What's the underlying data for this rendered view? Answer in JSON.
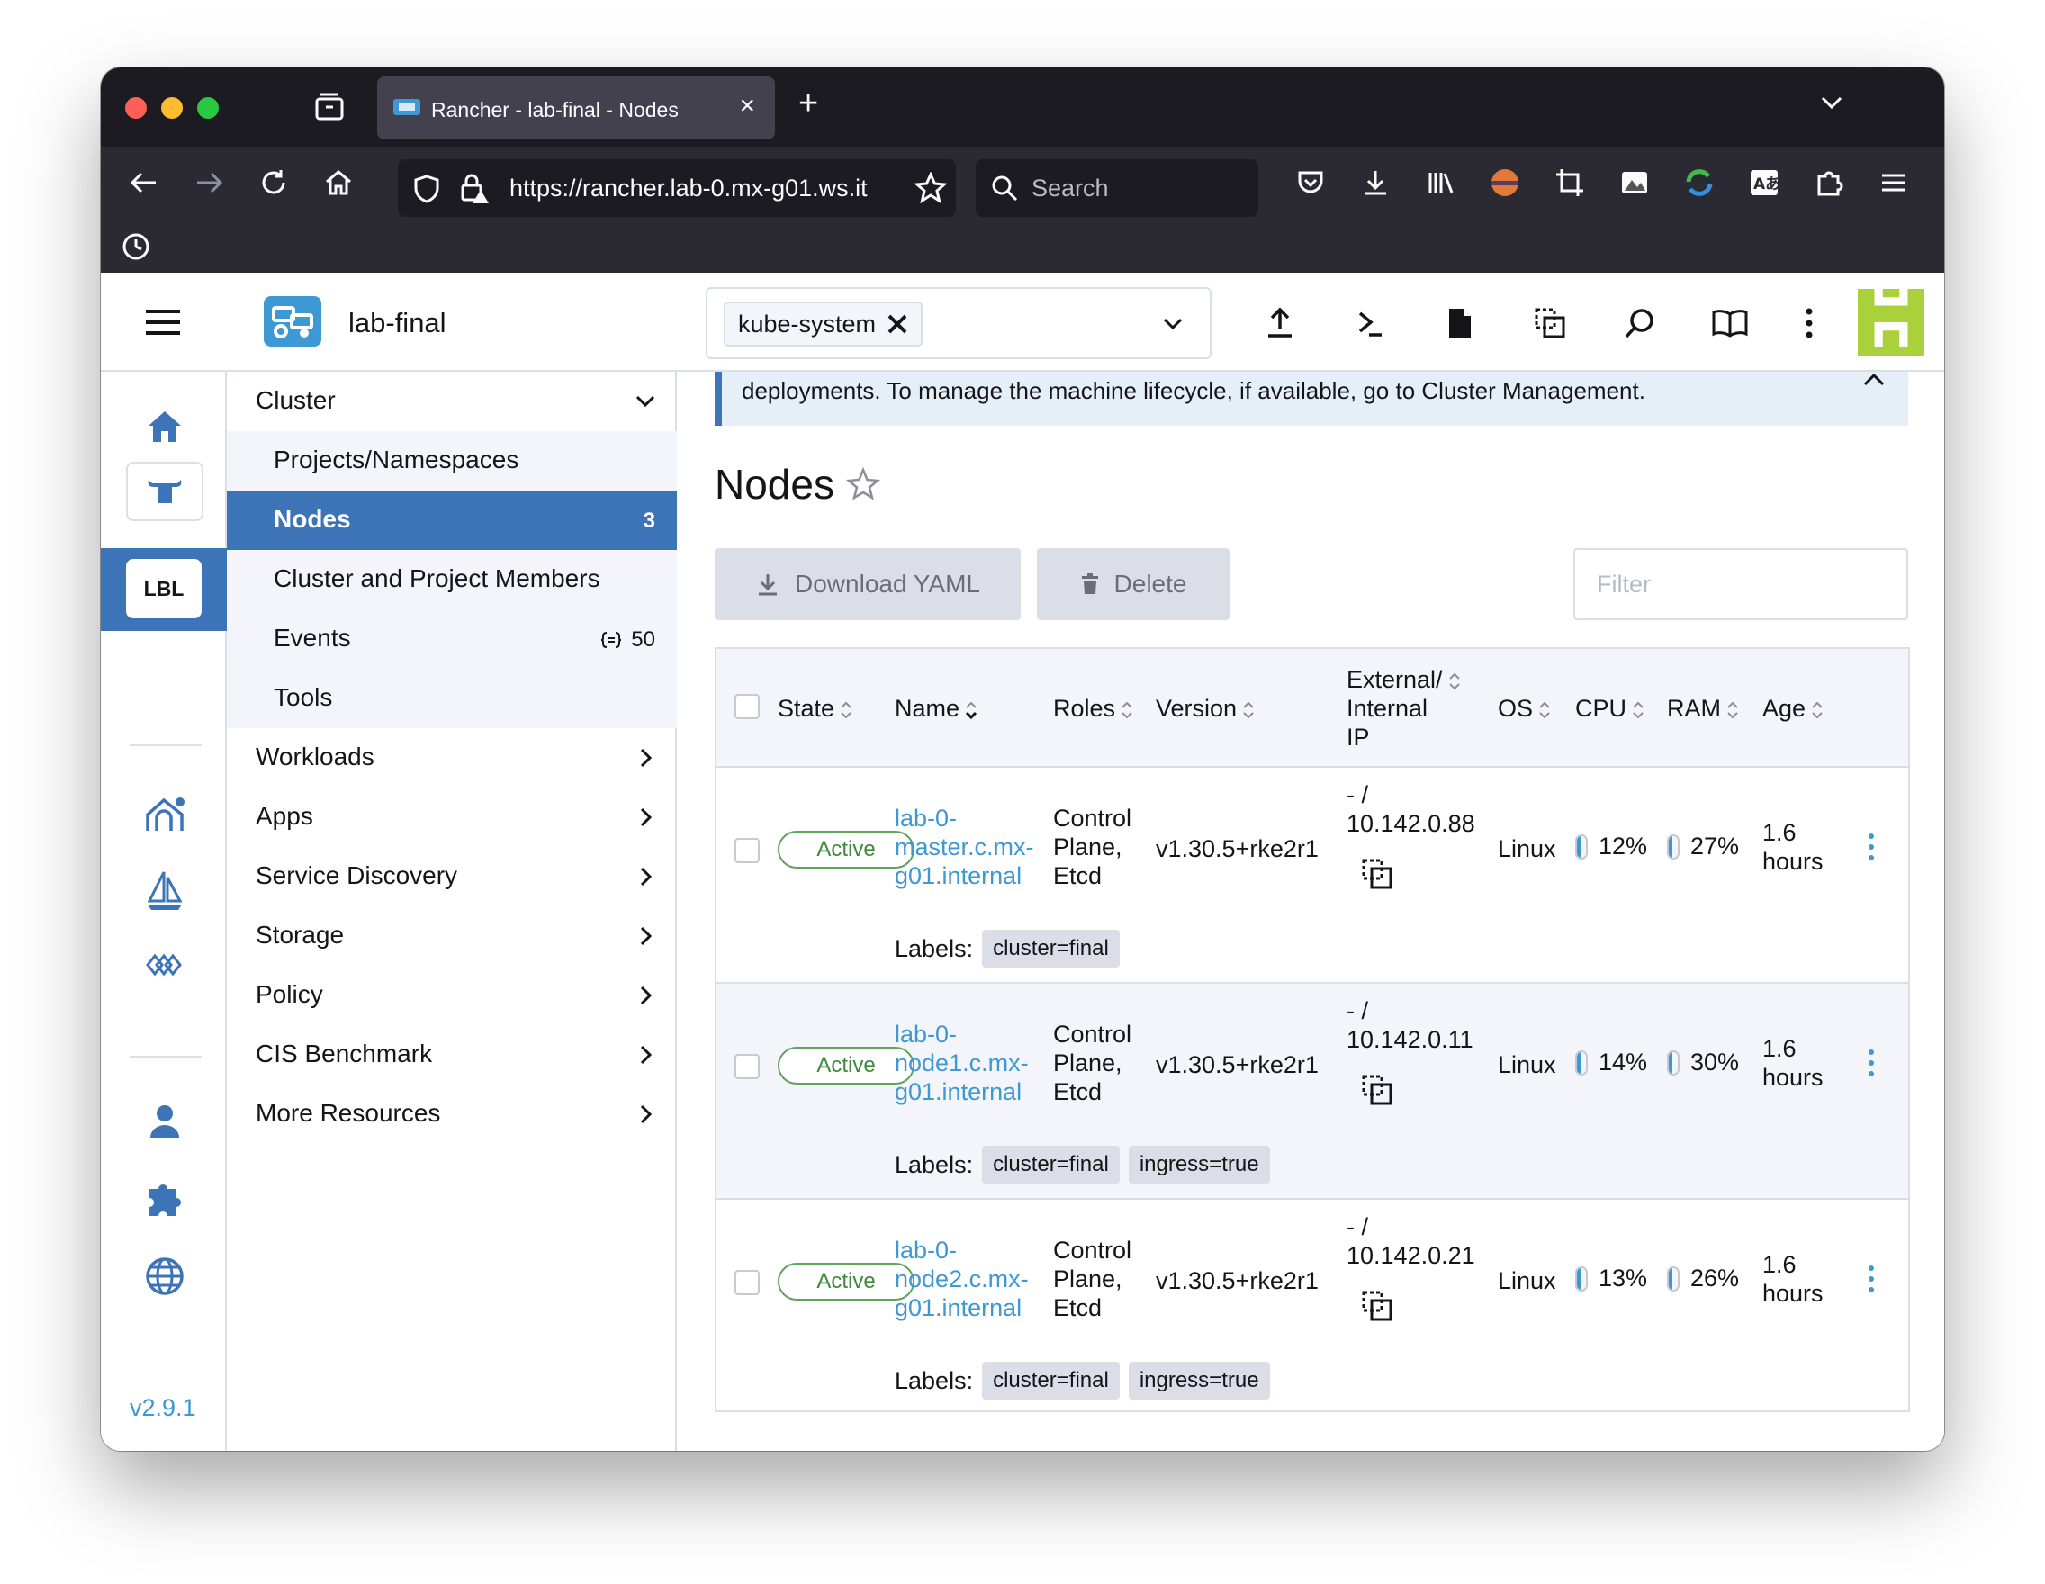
{
  "browser": {
    "tab_title": "Rancher - lab-final - Nodes",
    "url": "https://rancher.lab-0.mx-g01.ws.it",
    "search_placeholder": "Search"
  },
  "header": {
    "cluster_name": "lab-final",
    "namespace_chip": "kube-system"
  },
  "rail": {
    "cluster_badge": "LBL",
    "version": "v2.9.1"
  },
  "sidenav": {
    "cluster_group": "Cluster",
    "sub_items": [
      {
        "label": "Projects/Namespaces",
        "count": ""
      },
      {
        "label": "Nodes",
        "count": "3"
      },
      {
        "label": "Cluster and Project Members",
        "count": ""
      },
      {
        "label": "Events",
        "count": "50"
      },
      {
        "label": "Tools",
        "count": ""
      }
    ],
    "groups": [
      "Workloads",
      "Apps",
      "Service Discovery",
      "Storage",
      "Policy",
      "CIS Benchmark",
      "More Resources"
    ]
  },
  "main": {
    "banner_text": "deployments. To manage the machine lifecycle, if available, go to Cluster Management.",
    "title": "Nodes",
    "download_label": "Download YAML",
    "delete_label": "Delete",
    "filter_placeholder": "Filter",
    "columns": {
      "state": "State",
      "name": "Name",
      "roles": "Roles",
      "version": "Version",
      "ip_line1": "External/",
      "ip_line2": "Internal",
      "ip_line3": "IP",
      "os": "OS",
      "cpu": "CPU",
      "ram": "RAM",
      "age": "Age"
    },
    "labels_prefix": "Labels:",
    "rows": [
      {
        "state": "Active",
        "name_1": "lab-0-",
        "name_2": "master.c.mx-",
        "name_3": "g01.internal",
        "roles_1": "Control",
        "roles_2": "Plane,",
        "roles_3": "Etcd",
        "version": "v1.30.5+rke2r1",
        "ext_ip": "- /",
        "int_ip": "10.142.0.88",
        "os": "Linux",
        "cpu": "12%",
        "ram": "27%",
        "age_1": "1.6",
        "age_2": "hours",
        "labels": [
          "cluster=final"
        ]
      },
      {
        "state": "Active",
        "name_1": "lab-0-",
        "name_2": "node1.c.mx-",
        "name_3": "g01.internal",
        "roles_1": "Control",
        "roles_2": "Plane,",
        "roles_3": "Etcd",
        "version": "v1.30.5+rke2r1",
        "ext_ip": "- /",
        "int_ip": "10.142.0.11",
        "os": "Linux",
        "cpu": "14%",
        "ram": "30%",
        "age_1": "1.6",
        "age_2": "hours",
        "labels": [
          "cluster=final",
          "ingress=true"
        ]
      },
      {
        "state": "Active",
        "name_1": "lab-0-",
        "name_2": "node2.c.mx-",
        "name_3": "g01.internal",
        "roles_1": "Control",
        "roles_2": "Plane,",
        "roles_3": "Etcd",
        "version": "v1.30.5+rke2r1",
        "ext_ip": "- /",
        "int_ip": "10.142.0.21",
        "os": "Linux",
        "cpu": "13%",
        "ram": "26%",
        "age_1": "1.6",
        "age_2": "hours",
        "labels": [
          "cluster=final",
          "ingress=true"
        ]
      }
    ]
  },
  "colors": {
    "accent": "#3d74b7",
    "link": "#3d98d3",
    "active_green": "#5fa35f",
    "chrome_dark": "#1c1b22"
  }
}
